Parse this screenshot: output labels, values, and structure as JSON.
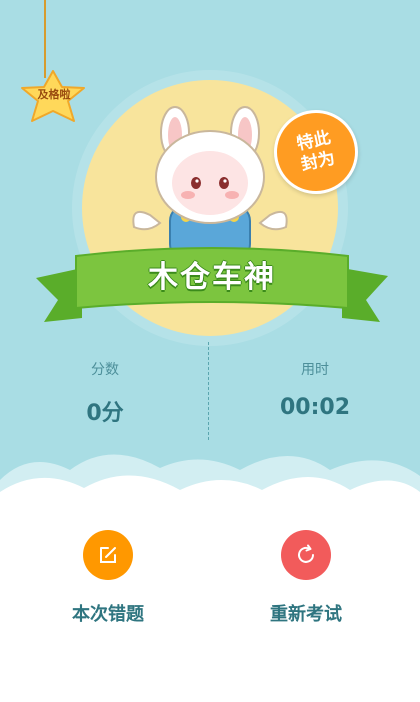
{
  "header": {
    "badge_label": "及格啦",
    "title_badge": "特此封为",
    "rank_title": "木仓车神"
  },
  "stats": {
    "score_label": "分数",
    "score_value": "0分",
    "time_label": "用时",
    "time_value": "00:02"
  },
  "actions": {
    "wrong_questions_label": "本次错题",
    "wrong_questions_icon": "edit-icon",
    "retake_label": "重新考试",
    "retake_icon": "refresh-icon"
  },
  "colors": {
    "background": "#a9dde4",
    "accent_orange": "#ff9800",
    "accent_red": "#f25b5b",
    "ribbon_green": "#7cc53f",
    "text_teal": "#2f7580"
  }
}
